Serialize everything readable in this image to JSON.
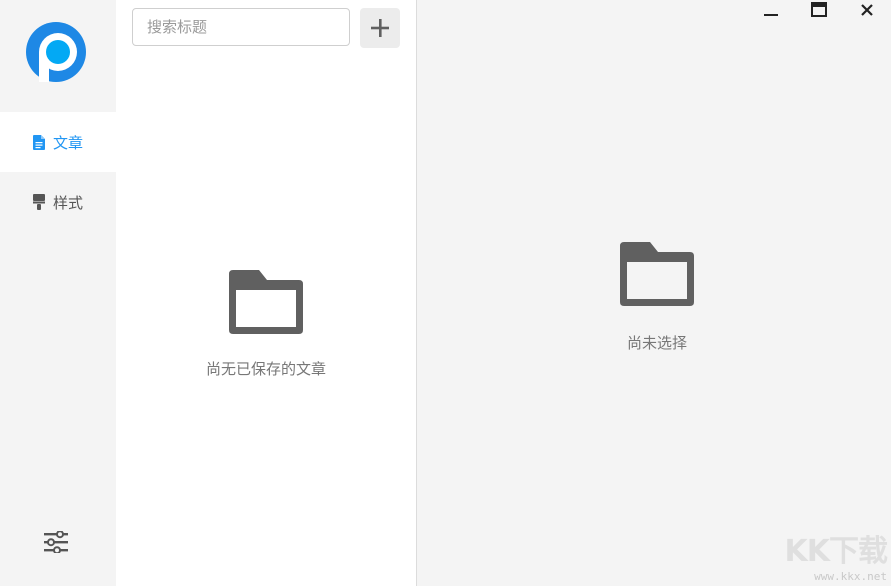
{
  "sidebar": {
    "items": [
      {
        "label": "文章",
        "icon": "document-icon",
        "active": true
      },
      {
        "label": "样式",
        "icon": "brush-icon",
        "active": false
      }
    ],
    "settings_icon": "sliders-icon",
    "logo": "app-logo"
  },
  "list": {
    "search_placeholder": "搜索标题",
    "search_value": "",
    "add_icon": "plus-icon",
    "empty_icon": "folder-icon",
    "empty_text": "尚无已保存的文章"
  },
  "detail": {
    "empty_icon": "folder-icon",
    "empty_text": "尚未选择"
  },
  "window_controls": {
    "minimize_icon": "minimize-icon",
    "maximize_icon": "maximize-icon",
    "close_icon": "close-icon"
  },
  "watermark": {
    "brand": "KK下载",
    "url": "www.kkx.net"
  },
  "colors": {
    "accent": "#2196f3",
    "logo_outer": "#1e88e5",
    "logo_inner": "#03a9f4",
    "icon_gray": "#606060"
  }
}
